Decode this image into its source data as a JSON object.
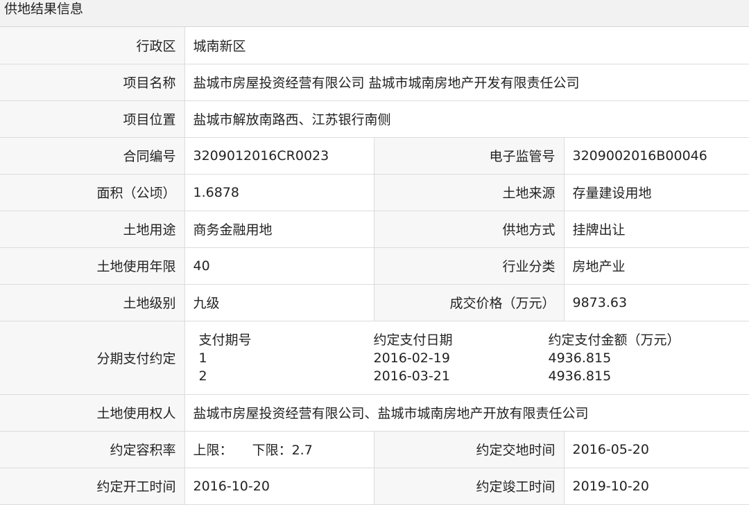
{
  "header": {
    "title": "供地结果信息"
  },
  "rows": {
    "district": {
      "label": "行政区",
      "value": "城南新区"
    },
    "project_name": {
      "label": "项目名称",
      "value": "盐城市房屋投资经营有限公司 盐城市城南房地产开发有限责任公司"
    },
    "project_location": {
      "label": "项目位置",
      "value": "盐城市解放南路西、江苏银行南侧"
    },
    "contract_no": {
      "label": "合同编号",
      "value": "3209012016CR0023"
    },
    "supervision_no": {
      "label": "电子监管号",
      "value": "3209002016B00046"
    },
    "area": {
      "label": "面积（公顷）",
      "value": "1.6878"
    },
    "land_source": {
      "label": "土地来源",
      "value": "存量建设用地"
    },
    "land_use": {
      "label": "土地用途",
      "value": "商务金融用地"
    },
    "supply_method": {
      "label": "供地方式",
      "value": "挂牌出让"
    },
    "use_years": {
      "label": "土地使用年限",
      "value": "40"
    },
    "industry": {
      "label": "行业分类",
      "value": "房地产业"
    },
    "land_level": {
      "label": "土地级别",
      "value": "九级"
    },
    "price": {
      "label": "成交价格（万元）",
      "value": "9873.63"
    },
    "installments": {
      "label": "分期支付约定",
      "headers": [
        "支付期号",
        "约定支付日期",
        "约定支付金额（万元）"
      ],
      "items": [
        {
          "no": "1",
          "date": "2016-02-19",
          "amount": "4936.815"
        },
        {
          "no": "2",
          "date": "2016-03-21",
          "amount": "4936.815"
        }
      ]
    },
    "land_user": {
      "label": "土地使用权人",
      "value": "盐城市房屋投资经营有限公司、盐城市城南房地产开放有限责任公司"
    },
    "far": {
      "label": "约定容积率",
      "upper_label": "上限：",
      "upper_value": "",
      "lower_label": "下限：",
      "lower_value": "2.7"
    },
    "handover_date": {
      "label": "约定交地时间",
      "value": "2016-05-20"
    },
    "start_date": {
      "label": "约定开工时间",
      "value": "2016-10-20"
    },
    "completion_date": {
      "label": "约定竣工时间",
      "value": "2019-10-20"
    }
  }
}
